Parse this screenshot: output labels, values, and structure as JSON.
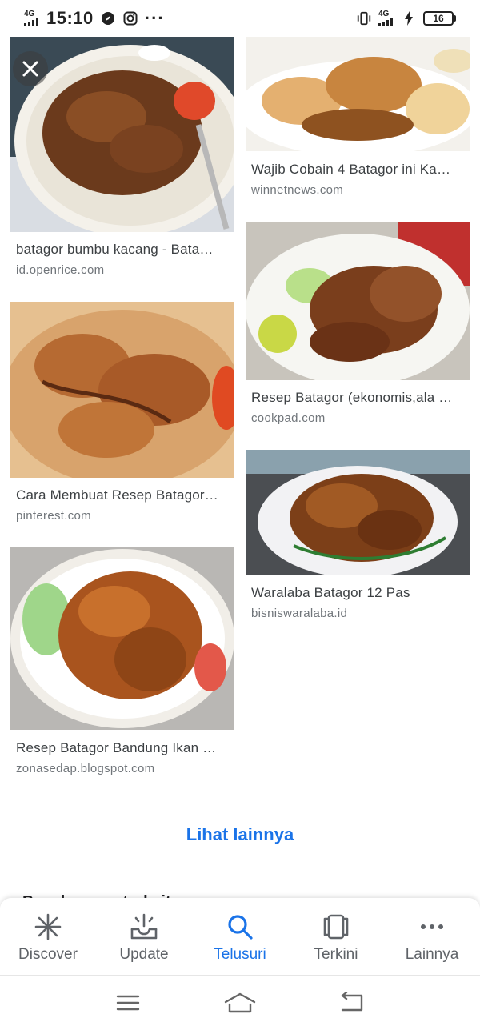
{
  "status_bar": {
    "network_label": "4G",
    "time": "15:10",
    "icons": [
      "compass-icon",
      "instagram-icon",
      "more-dots-icon"
    ],
    "right_icons": [
      "vibrate-icon",
      "4g-signal-icon",
      "charging-icon"
    ],
    "network_label_right": "4G",
    "battery_level": "16"
  },
  "results": [
    {
      "title": "batagor bumbu kacang - Bata…",
      "source": "id.openrice.com",
      "image": "batagor-plate-floral-photo"
    },
    {
      "title": "Wajib Cobain 4 Batagor ini Ka…",
      "source": "winnetnews.com",
      "image": "batagor-dumplings-photo"
    },
    {
      "title": "Cara Membuat Resep Batagor…",
      "source": "pinterest.com",
      "image": "batagor-peanut-sauce-photo"
    },
    {
      "title": "Resep Batagor (ekonomis,ala …",
      "source": "cookpad.com",
      "image": "batagor-cucumber-lime-photo"
    },
    {
      "title": "Resep Batagor Bandung Ikan …",
      "source": "zonasedap.blogspot.com",
      "image": "batagor-bandung-photo"
    },
    {
      "title": "Waralaba Batagor 12 Pas",
      "source": "bisniswaralaba.id",
      "image": "batagor-plate-outdoor-photo"
    }
  ],
  "more_link": "Lihat lainnya",
  "peek_heading": "Penelusuran terkait",
  "bottom_nav": [
    {
      "label": "Discover",
      "icon": "asterisk-icon",
      "active": false
    },
    {
      "label": "Update",
      "icon": "update-tray-icon",
      "active": false
    },
    {
      "label": "Telusuri",
      "icon": "search-icon",
      "active": true
    },
    {
      "label": "Terkini",
      "icon": "recent-cards-icon",
      "active": false
    },
    {
      "label": "Lainnya",
      "icon": "more-horizontal-icon",
      "active": false
    }
  ],
  "system_nav": [
    "menu-icon",
    "home-icon",
    "back-icon"
  ],
  "colors": {
    "accent": "#1a73e8",
    "text_primary": "#3c4043",
    "text_secondary": "#70757a"
  }
}
